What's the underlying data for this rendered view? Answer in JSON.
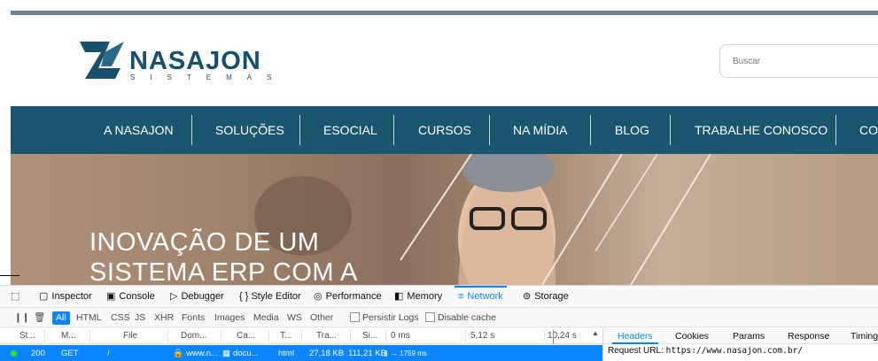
{
  "site": {
    "logo": {
      "name": "NASAJON",
      "sub": "SISTEMAS"
    },
    "search_placeholder": "Buscar",
    "nav": [
      "A NASAJON",
      "SOLUÇÕES",
      "ESOCIAL",
      "CURSOS",
      "NA MÍDIA",
      "BLOG",
      "TRABALHE CONOSCO",
      "CO"
    ],
    "hero_lines": [
      "INOVAÇÃO DE UM",
      "SISTEMA ERP COM A"
    ],
    "colors": {
      "brand": "#17506b",
      "nav_bg": "#1b5670",
      "topbar": "#6e8393"
    }
  },
  "devtools": {
    "tabs": [
      {
        "label": "Inspector",
        "icon": "inspector-icon"
      },
      {
        "label": "Console",
        "icon": "console-icon"
      },
      {
        "label": "Debugger",
        "icon": "debugger-icon"
      },
      {
        "label": "{ } Style Editor",
        "icon": ""
      },
      {
        "label": "Performance",
        "icon": "performance-icon"
      },
      {
        "label": "Memory",
        "icon": "memory-icon"
      },
      {
        "label": "Network",
        "icon": "network-icon"
      },
      {
        "label": "Storage",
        "icon": "storage-icon"
      }
    ],
    "active_tab": "Network",
    "filters": [
      "All",
      "HTML",
      "CSS",
      "JS",
      "XHR",
      "Fonts",
      "Images",
      "Media",
      "WS",
      "Other"
    ],
    "persist_logs": "Persistir Logs",
    "disable_cache": "Disable cache",
    "columns": [
      "St...",
      "M...",
      "File",
      "Dom...",
      "Ca...",
      "T...",
      "Tra...",
      "Si...",
      "0 ms",
      "5,12 s",
      "10,24 s"
    ],
    "row": {
      "status": "200",
      "method": "GET",
      "file": "/",
      "domain": "www.n...",
      "cause": "docu...",
      "type": "html",
      "transferred": "27,18 KB",
      "size": "111,21 KB",
      "timing": "→ 1759 ms"
    },
    "side_tabs": [
      "Headers",
      "Cookies",
      "Params",
      "Response",
      "Timing"
    ],
    "request_url_label": "Request URL:",
    "request_url": "https://www.nasajon.com.br/"
  }
}
